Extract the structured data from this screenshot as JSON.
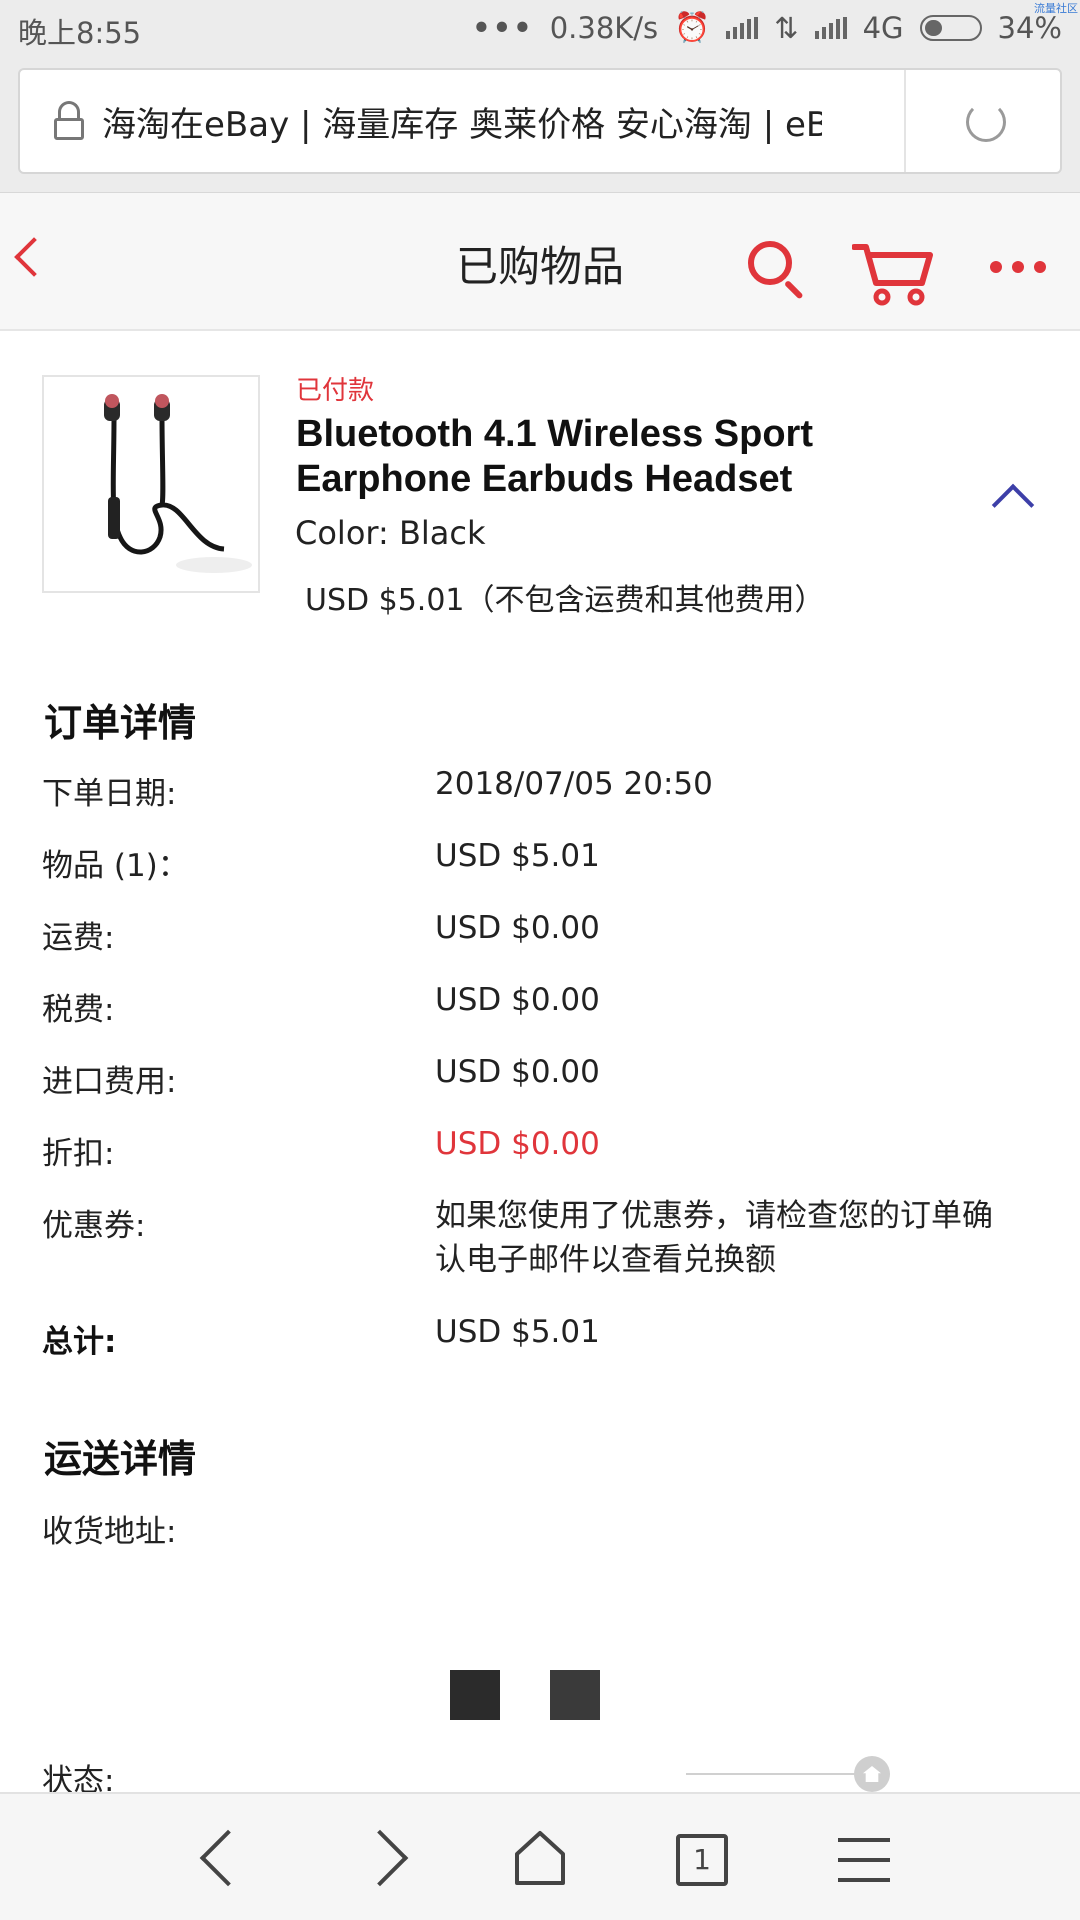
{
  "status_bar": {
    "time": "晚上8:55",
    "dots": "•••",
    "speed": "0.38K/s",
    "network": "4G",
    "battery": "34%",
    "corner_tag": "流量社区"
  },
  "browser": {
    "url_title": "海淘在eBay | 海量库存 奥莱价格 安心海淘 | eBay"
  },
  "header": {
    "title": "已购物品"
  },
  "product": {
    "status": "已付款",
    "name": "Bluetooth 4.1 Wireless Sport Earphone Earbuds Headset",
    "color": "Color: Black",
    "price": "USD $5.01（不包含运费和其他费用）"
  },
  "order_details": {
    "title": "订单详情",
    "rows": [
      {
        "label": "下单日期:",
        "value": "2018/07/05 20:50"
      },
      {
        "label": "物品 (1)：",
        "value": "USD $5.01"
      },
      {
        "label": "运费:",
        "value": "USD $0.00"
      },
      {
        "label": "税费:",
        "value": "USD $0.00"
      },
      {
        "label": "进口费用:",
        "value": "USD $0.00"
      },
      {
        "label": "折扣:",
        "value": "USD $0.00"
      },
      {
        "label": "优惠券:",
        "value": "如果您使用了优惠券，请检查您的订单确认电子邮件以查看兑换额"
      },
      {
        "label": "总计:",
        "value": "USD $5.01"
      }
    ]
  },
  "shipping_details": {
    "title": "运送详情",
    "address_label": "收货地址:",
    "status_label": "状态:"
  },
  "bottom_nav": {
    "tab_count": "1"
  },
  "colors": {
    "accent_red": "#e0353b",
    "chevron_blue": "#3d3fa8"
  }
}
